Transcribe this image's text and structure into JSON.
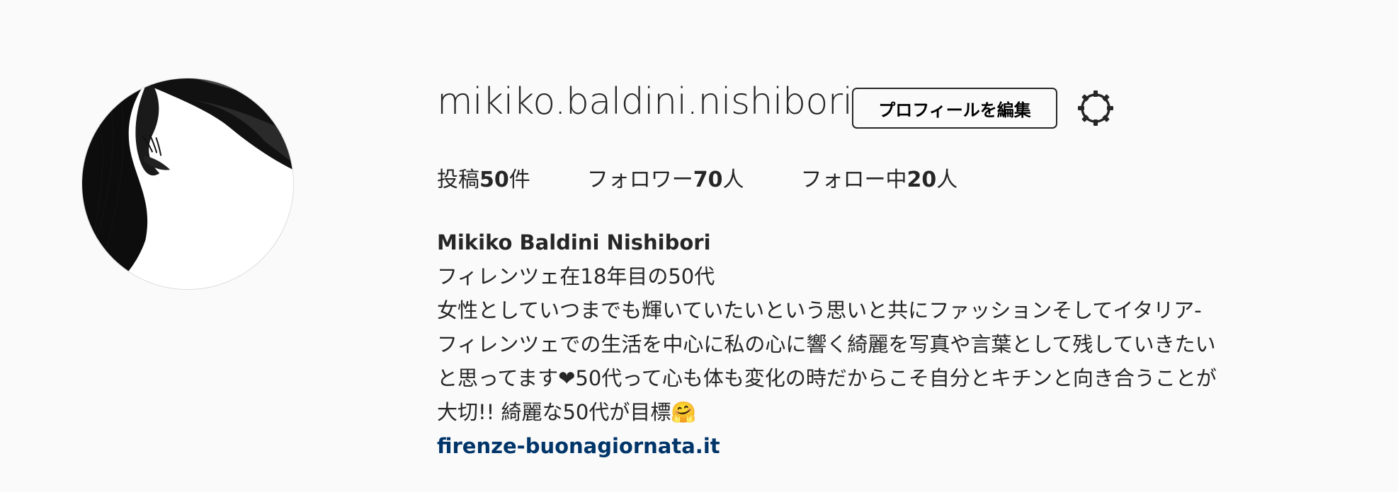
{
  "profile": {
    "username": "mikiko.baldini.nishibori",
    "edit_button_label": "プロフィールを編集",
    "settings_icon": "gear-icon"
  },
  "stats": {
    "posts_label": "投稿",
    "posts_count": "50",
    "posts_unit": "件",
    "followers_label": "フォロワー",
    "followers_count": "70",
    "followers_unit": "人",
    "following_label": "フォロー中",
    "following_count": "20",
    "following_unit": "人"
  },
  "bio": {
    "full_name": "Mikiko Baldini Nishibori",
    "lines": [
      "フィレンツェ在18年目の50代",
      "女性としていつまでも輝いていたいという思いと共にファッションそしてイタリア-",
      "フィレンツェでの生活を中心に私の心に響く綺麗を写真や言葉として残していきたい",
      "と思ってます❤50代って心も体も変化の時だからこそ自分とキチンと向き合うことが",
      "大切!! 綺麗な50代が目標🤗"
    ],
    "website": "firenze-buonagiornata.it"
  },
  "colors": {
    "background": "#fafafa",
    "text": "#262626",
    "link": "#003569",
    "border": "#dbdbdb"
  }
}
